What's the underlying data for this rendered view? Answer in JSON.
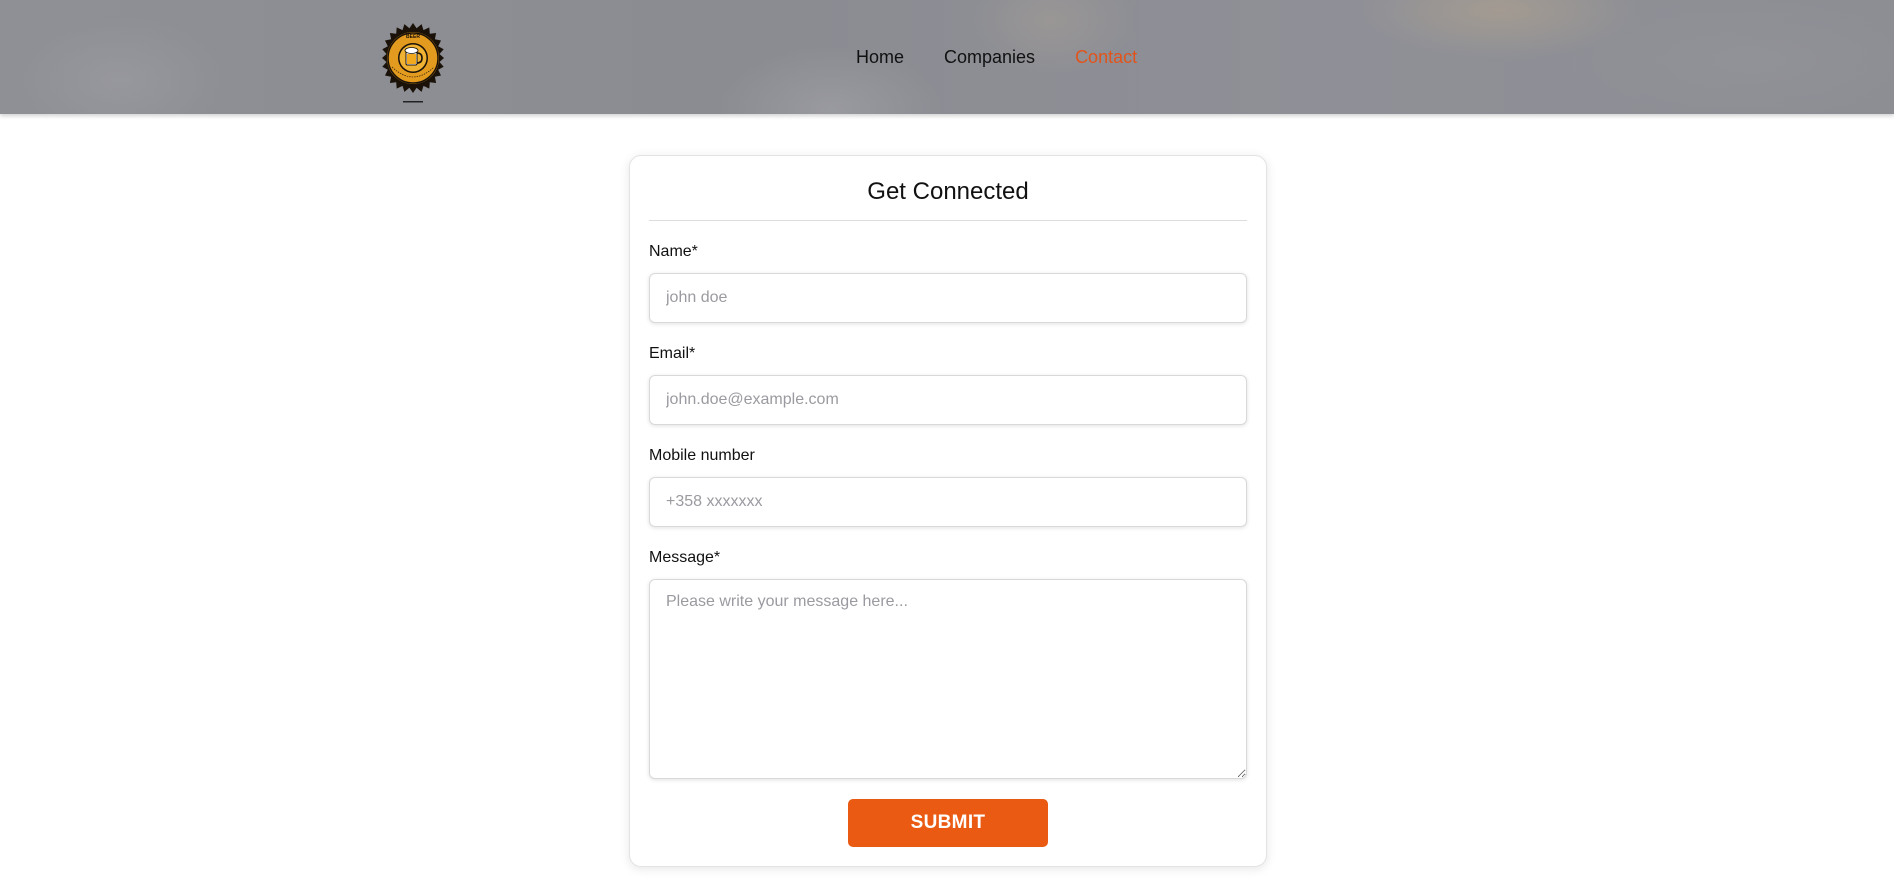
{
  "header": {
    "logo_icon": "beer-brew-house-logo",
    "logo_text": [
      "BEER",
      "THE BREW HOUSE"
    ],
    "nav": [
      {
        "label": "Home",
        "active": false
      },
      {
        "label": "Companies",
        "active": false
      },
      {
        "label": "Contact",
        "active": true
      }
    ],
    "active_color": "#e2531a"
  },
  "form": {
    "title": "Get Connected",
    "fields": [
      {
        "label": "Name*",
        "placeholder": "john doe",
        "value": ""
      },
      {
        "label": "Email*",
        "placeholder": "john.doe@example.com",
        "value": ""
      },
      {
        "label": "Mobile number",
        "placeholder": "+358 xxxxxxx",
        "value": ""
      },
      {
        "label": "Message*",
        "placeholder": "Please write your message here...",
        "value": ""
      }
    ],
    "submit_label": "SUBMIT",
    "submit_color": "#ea5a12"
  }
}
